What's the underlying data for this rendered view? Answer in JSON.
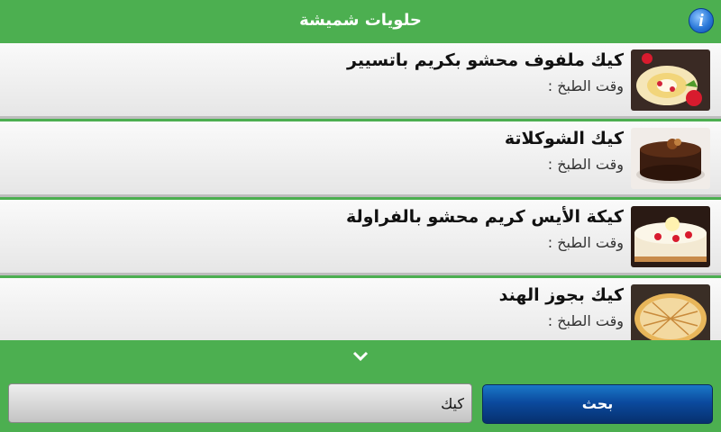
{
  "header": {
    "title": "حلويات شميشة",
    "info_icon": "info-icon"
  },
  "list": {
    "items": [
      {
        "title": "كيك ملفوف محشو بكريم باتسيير",
        "subtitle": "وقت الطبخ :"
      },
      {
        "title": "كيك الشوكلاتة",
        "subtitle": "وقت الطبخ :"
      },
      {
        "title": "كيكة الأيس كريم محشو بالفراولة",
        "subtitle": "وقت الطبخ :"
      },
      {
        "title": "كيك بجوز الهند",
        "subtitle": "وقت الطبخ :"
      }
    ]
  },
  "search": {
    "value": "كيك",
    "button_label": "بحث"
  },
  "colors": {
    "accent": "#4caf50",
    "button": "#0b4a9e"
  }
}
